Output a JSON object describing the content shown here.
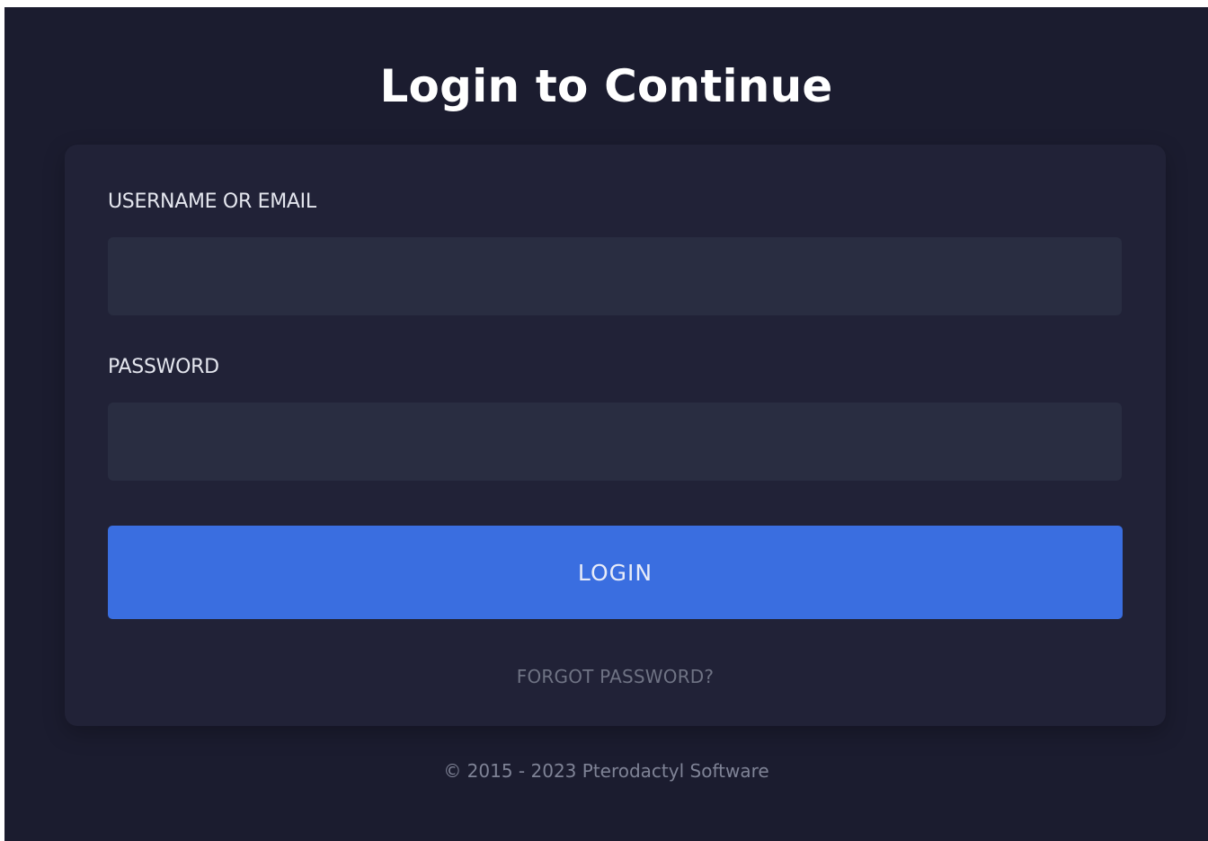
{
  "page": {
    "title": "Login to Continue"
  },
  "form": {
    "username_label": "USERNAME OR EMAIL",
    "username_value": "",
    "password_label": "PASSWORD",
    "password_value": "",
    "login_label": "LOGIN",
    "forgot_label": "FORGOT PASSWORD?"
  },
  "footer": {
    "copyright": "© 2015 - 2023 Pterodactyl Software"
  },
  "colors": {
    "background": "#1b1c2f",
    "card": "#212237",
    "input": "#292d41",
    "accent": "#3a6ee0"
  }
}
